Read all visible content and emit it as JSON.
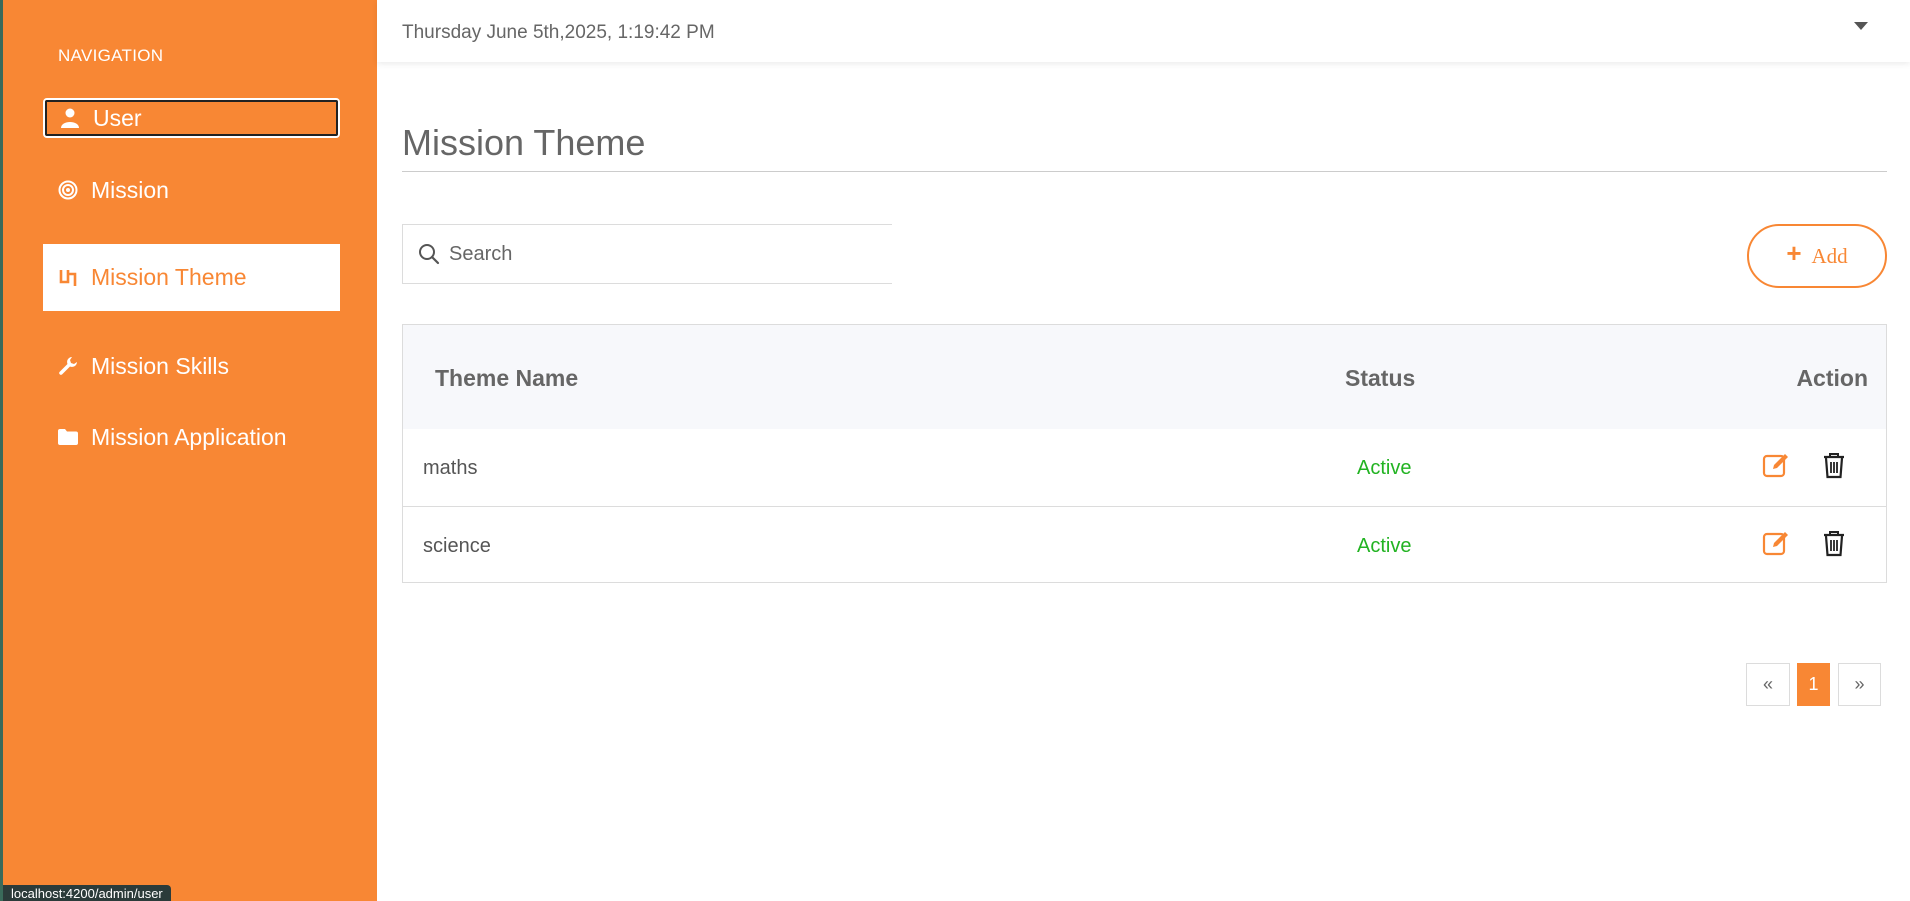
{
  "sidebar": {
    "heading": "NAVIGATION",
    "items": [
      {
        "label": "User",
        "icon": "user-icon"
      },
      {
        "label": "Mission",
        "icon": "target-icon"
      },
      {
        "label": "Mission Theme",
        "icon": "theme-icon"
      },
      {
        "label": "Mission Skills",
        "icon": "wrench-icon"
      },
      {
        "label": "Mission Application",
        "icon": "folder-icon"
      }
    ],
    "active_item": "Mission Theme",
    "status_url": "localhost:4200/admin/user"
  },
  "header": {
    "datetime": "Thursday June 5th,2025, 1:19:42 PM"
  },
  "main": {
    "title": "Mission Theme",
    "search": {
      "placeholder": "Search",
      "value": ""
    },
    "add_label": "Add",
    "table": {
      "columns": [
        "Theme Name",
        "Status",
        "Action"
      ],
      "rows": [
        {
          "name": "maths",
          "status": "Active"
        },
        {
          "name": "science",
          "status": "Active"
        }
      ]
    },
    "pagination": {
      "prev": "«",
      "current": "1",
      "next": "»"
    }
  },
  "colors": {
    "accent": "#f88734",
    "active_status": "#22b322"
  }
}
